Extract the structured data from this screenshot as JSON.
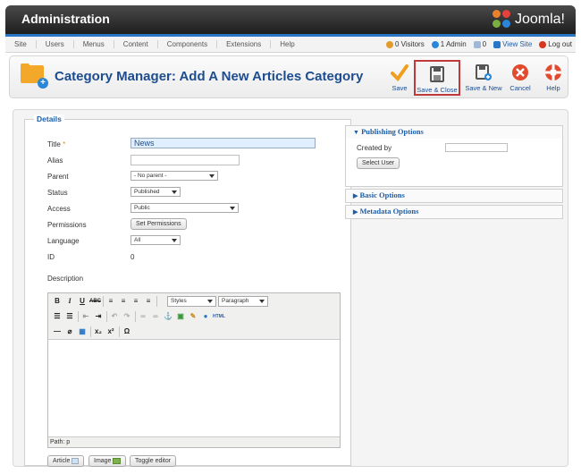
{
  "header": {
    "title": "Administration",
    "logo_text": "Joomla!"
  },
  "menu": {
    "items": [
      "Site",
      "Users",
      "Menus",
      "Content",
      "Components",
      "Extensions",
      "Help"
    ],
    "visitors": "0 Visitors",
    "admin": "1 Admin",
    "messages": "0",
    "view_site": "View Site",
    "logout": "Log out"
  },
  "toolbar": {
    "page_title": "Category Manager: Add A New Articles Category",
    "buttons": {
      "save": "Save",
      "save_close": "Save & Close",
      "save_new": "Save & New",
      "cancel": "Cancel",
      "help": "Help"
    }
  },
  "details": {
    "legend": "Details",
    "title_label": "Title",
    "required_star": "*",
    "title_value": "News",
    "alias_label": "Alias",
    "alias_value": "",
    "parent_label": "Parent",
    "parent_value": "- No parent -",
    "status_label": "Status",
    "status_value": "Published",
    "access_label": "Access",
    "access_value": "Public",
    "permissions_label": "Permissions",
    "permissions_button": "Set Permissions",
    "language_label": "Language",
    "language_value": "All",
    "id_label": "ID",
    "id_value": "0",
    "description_label": "Description"
  },
  "editor": {
    "styles_value": "Styles",
    "format_value": "Paragraph",
    "path": "Path: p",
    "article_button": "Article",
    "image_button": "Image",
    "toggle_button": "Toggle editor"
  },
  "publishing": {
    "title": "Publishing Options",
    "created_by_label": "Created by",
    "select_user_button": "Select User",
    "basic_title": "Basic Options",
    "metadata_title": "Metadata Options"
  },
  "colors": {
    "accent": "#1d5ea8",
    "header": "#2b2b2b",
    "strip": "#2a76c6",
    "highlight": "#c0393b"
  }
}
